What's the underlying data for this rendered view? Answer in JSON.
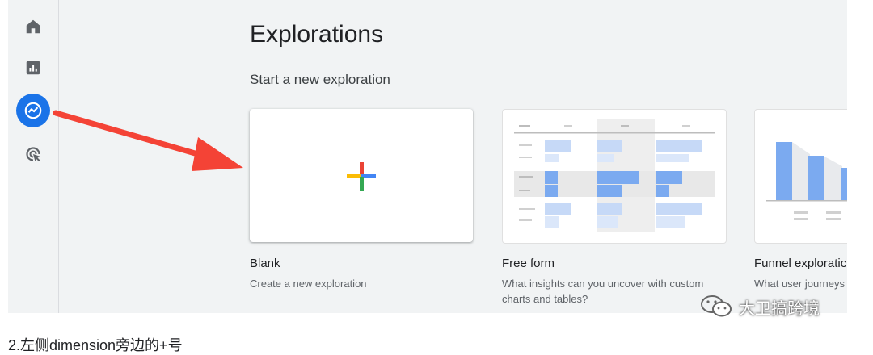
{
  "header": {
    "title": "Explorations",
    "subtitle": "Start a new exploration"
  },
  "nav": {
    "items": [
      {
        "id": "home",
        "icon": "home-icon"
      },
      {
        "id": "reports",
        "icon": "bar-chart-icon"
      },
      {
        "id": "explore",
        "icon": "explore-icon",
        "active": true
      },
      {
        "id": "advertising",
        "icon": "advertising-icon"
      }
    ]
  },
  "templates": [
    {
      "id": "blank",
      "title": "Blank",
      "description": "Create a new exploration"
    },
    {
      "id": "free-form",
      "title": "Free form",
      "description": "What insights can you uncover with custom charts and tables?"
    },
    {
      "id": "funnel",
      "title": "Funnel exploratic",
      "description": "What user journeys and breakdown wit"
    }
  ],
  "annotation": {
    "caption": "2.左侧dimension旁边的+号"
  },
  "watermark": {
    "text": "大卫搞跨境"
  },
  "colors": {
    "accent": "#1a73e8",
    "arrow": "#f44336",
    "plus_red": "#ea4335",
    "plus_blue": "#4285f4",
    "plus_yellow": "#fbbc04",
    "plus_green": "#34a853"
  }
}
